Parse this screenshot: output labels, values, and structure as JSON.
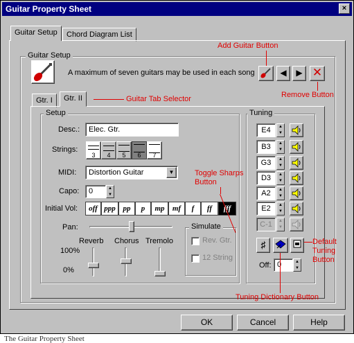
{
  "window": {
    "title": "Guitar Property Sheet",
    "close_glyph": "×"
  },
  "tabs": [
    {
      "label": "Guitar Setup"
    },
    {
      "label": "Chord Diagram List"
    }
  ],
  "guitar_setup": {
    "group_label": "Guitar Setup",
    "info_text": "A maximum of seven guitars may be used in each song",
    "guitar_tabs": [
      {
        "label": "Gtr. I"
      },
      {
        "label": "Gtr. II"
      }
    ]
  },
  "setup": {
    "group_label": "Setup",
    "desc_label": "Desc.:",
    "desc_value": "Elec. Gtr.",
    "strings_label": "Strings:",
    "string_options": [
      "3",
      "4",
      "5",
      "6",
      "7"
    ],
    "selected_string": "6",
    "midi_label": "MIDI:",
    "midi_value": "Distortion Guitar",
    "capo_label": "Capo:",
    "capo_value": "0",
    "initial_vol_label": "Initial Vol:",
    "volume_options": [
      "off",
      "ppp",
      "pp",
      "p",
      "mp",
      "mf",
      "f",
      "ff",
      "fff"
    ],
    "selected_volume": "fff",
    "pan_label": "Pan:",
    "pan_level": 0.5,
    "effects": [
      {
        "label": "Reverb"
      },
      {
        "label": "Chorus"
      },
      {
        "label": "Tremolo"
      }
    ],
    "scale_top": "100%",
    "scale_bottom": "0%",
    "simulate_label": "Simulate",
    "simulate_options": [
      {
        "label": "Rev. Gtr."
      },
      {
        "label": "12 String"
      }
    ]
  },
  "tuning": {
    "group_label": "Tuning",
    "notes": [
      "E4",
      "B3",
      "G3",
      "D3",
      "A2",
      "E2",
      "C-1"
    ],
    "sharp_glyph": "♯",
    "off_label": "Off:",
    "off_value": "0"
  },
  "dialog_buttons": {
    "ok": "OK",
    "cancel": "Cancel",
    "help": "Help"
  },
  "annotations": {
    "add_guitar": "Add Guitar Button",
    "remove": "Remove Button",
    "tab_selector": "Guitar Tab Selector",
    "toggle_sharps": "Toggle Sharps Button",
    "default_tuning": "Default Tuning Button",
    "tuning_dictionary": "Tuning Dictionary Button"
  },
  "caption": "The Guitar Property Sheet",
  "colors": {
    "title_bar": "#000080",
    "annotation": "#e00000",
    "face": "#c0c0c0"
  }
}
